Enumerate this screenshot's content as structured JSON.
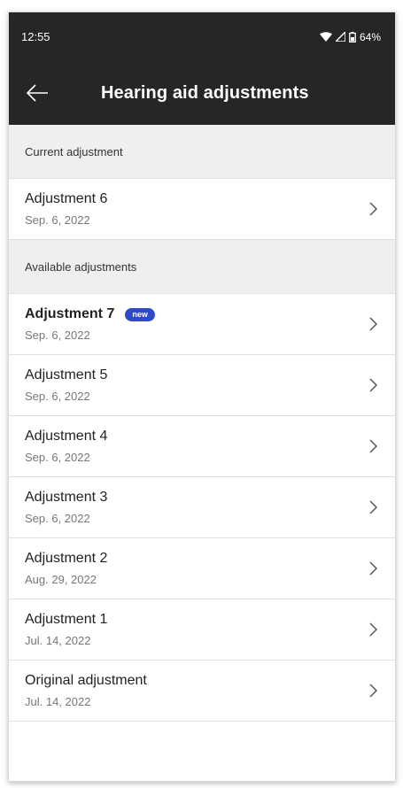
{
  "status_bar": {
    "time": "12:55",
    "battery": "64%",
    "icons": [
      "wifi-icon",
      "cell-signal-icon",
      "battery-icon"
    ]
  },
  "app_bar": {
    "title": "Hearing aid adjustments",
    "back_icon": "arrow-left-icon"
  },
  "current_section": {
    "header": "Current adjustment",
    "items": [
      {
        "title": "Adjustment 6",
        "date": "Sep. 6, 2022"
      }
    ]
  },
  "available_section": {
    "header": "Available adjustments",
    "items": [
      {
        "title": "Adjustment 7",
        "date": "Sep. 6, 2022",
        "badge": "new",
        "bold": true
      },
      {
        "title": "Adjustment 5",
        "date": "Sep. 6, 2022"
      },
      {
        "title": "Adjustment 4",
        "date": "Sep. 6, 2022"
      },
      {
        "title": "Adjustment 3",
        "date": "Sep. 6, 2022"
      },
      {
        "title": "Adjustment 2",
        "date": "Aug. 29, 2022"
      },
      {
        "title": "Adjustment 1",
        "date": "Jul. 14, 2022"
      },
      {
        "title": "Original adjustment",
        "date": "Jul. 14, 2022"
      }
    ]
  },
  "colors": {
    "app_bar": "#262626",
    "section_header": "#efefef",
    "badge": "#2f49c9"
  }
}
